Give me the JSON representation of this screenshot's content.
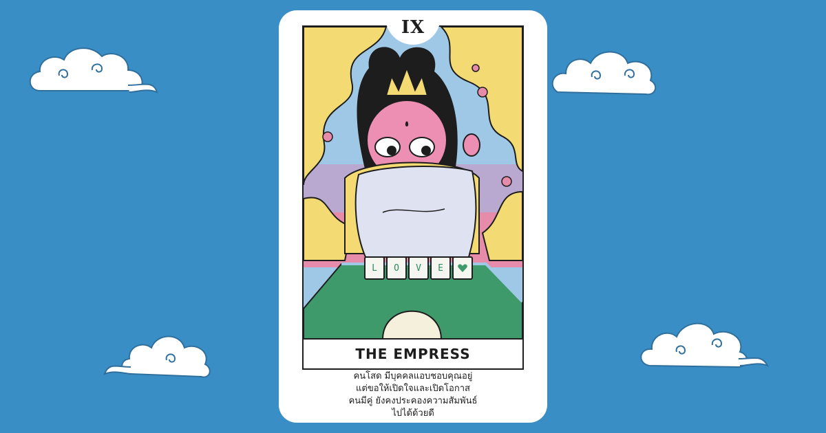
{
  "colors": {
    "background": "#3a8ec6",
    "card": "#ffffff",
    "cloud": "#ffffff",
    "cloud_outline": "#2f6f9e",
    "table_green": "#3e9a6a",
    "sky_yellow": "#f3da73",
    "sky_pink": "#e78bab",
    "skin_pink": "#ec8fb2",
    "cloth": "#dfe2f1"
  },
  "card": {
    "numeral": "IX",
    "title": "THE EMPRESS",
    "caption_lines": [
      "คนโสด  มีบุคคลแอบชอบคุณอยู่",
      "แต่ขอให้เปิดใจและเปิดโอกาส",
      "คนมีคู่ ยังคงประคองความสัมพันธ์",
      "ไปได้ด้วยดี"
    ],
    "tiles": [
      "L",
      "O",
      "V",
      "E",
      "heart-icon"
    ]
  },
  "decor": {
    "cloud_icons": [
      "cloud-icon",
      "cloud-icon",
      "cloud-icon",
      "cloud-icon"
    ]
  }
}
